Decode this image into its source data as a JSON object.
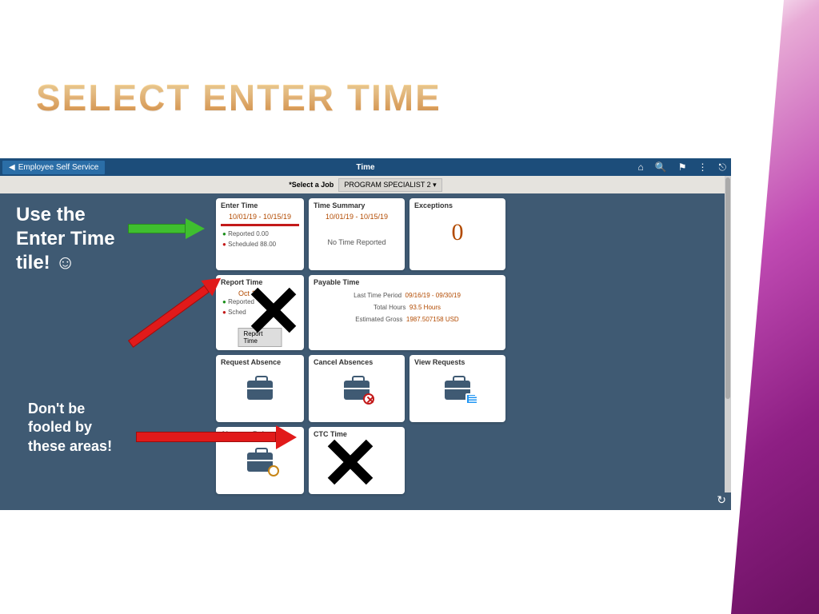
{
  "slide": {
    "title": "SELECT ENTER TIME",
    "annotation1": "Use the Enter Time tile! ☺",
    "annotation2": "Don't be fooled by these areas!"
  },
  "topbar": {
    "back": "Employee Self Service",
    "title": "Time"
  },
  "jobrow": {
    "label": "*Select a Job",
    "value": "PROGRAM SPECIALIST 2  ▾"
  },
  "tiles": {
    "enterTime": {
      "title": "Enter Time",
      "date": "10/01/19 - 10/15/19",
      "reported": "Reported 0.00",
      "scheduled": "Scheduled 88.00"
    },
    "timeSummary": {
      "title": "Time Summary",
      "date": "10/01/19 - 10/15/19",
      "msg": "No Time Reported"
    },
    "exceptions": {
      "title": "Exceptions",
      "value": "0"
    },
    "reportTime": {
      "title": "Report Time",
      "date": "Oct 13",
      "reported": "Reported",
      "scheduled": "Sched",
      "button": "Report Time"
    },
    "payable": {
      "title": "Payable Time",
      "l1a": "Last Time Period",
      "l1b": "09/16/19 - 09/30/19",
      "l2a": "Total Hours",
      "l2b": "93.5 Hours",
      "l3a": "Estimated Gross",
      "l3b": "1987.507158 USD"
    },
    "reqAbs": {
      "title": "Request Absence"
    },
    "cancelAbs": {
      "title": "Cancel Absences"
    },
    "viewReq": {
      "title": "View Requests"
    },
    "absBal": {
      "title": "Absence Balances"
    },
    "ctc": {
      "title": "CTC Time"
    }
  }
}
